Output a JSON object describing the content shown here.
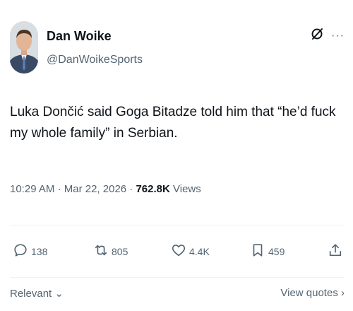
{
  "author": {
    "display_name": "Dan Woike",
    "handle": "@DanWoikeSports"
  },
  "tweet": {
    "text": "Luka Dončić said Goga Bitadze told him that “he’d fuck my whole family” in Serbian.",
    "time": "10:29 AM",
    "date": "Mar 22, 2026",
    "views_count": "762.8K",
    "views_label": "Views",
    "separator": "·"
  },
  "actions": {
    "replies": "138",
    "reposts": "805",
    "likes": "4.4K",
    "bookmarks": "459"
  },
  "footer": {
    "sort_label": "Relevant",
    "sort_chevron": "⌄",
    "view_quotes": "View quotes",
    "view_quotes_chevron": "›"
  },
  "icons": {
    "more": "···",
    "grok": "grok-icon",
    "reply": "reply-icon",
    "repost": "repost-icon",
    "like": "like-icon",
    "bookmark": "bookmark-icon",
    "share": "share-icon"
  }
}
